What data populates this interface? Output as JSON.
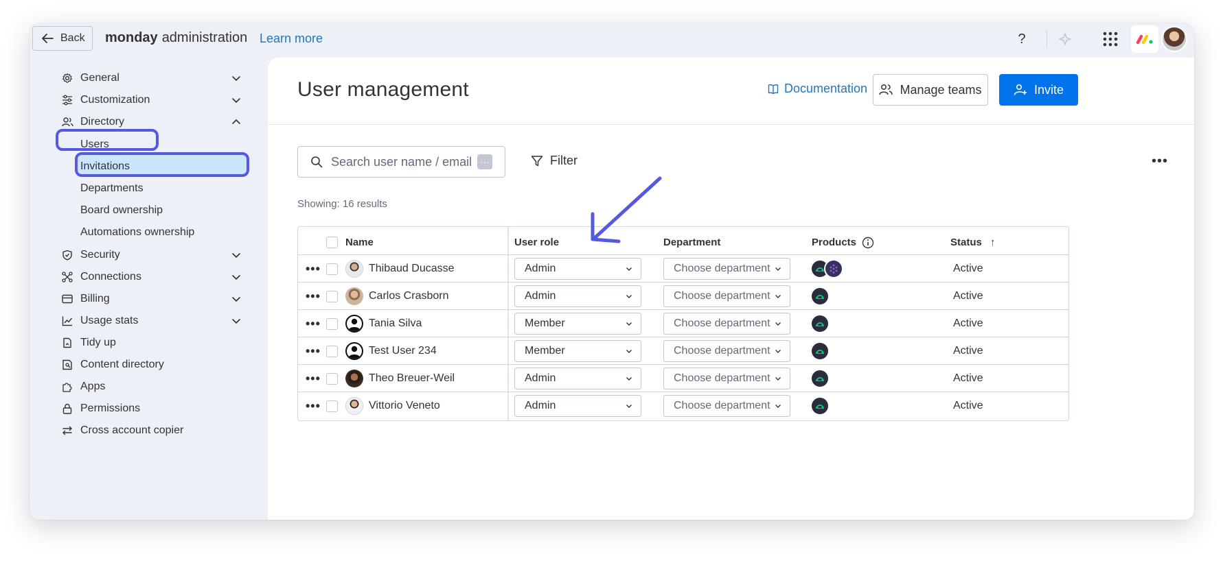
{
  "topbar": {
    "back_label": "Back",
    "brand_bold": "monday",
    "brand_rest": "administration",
    "learn_more": "Learn more",
    "help_label": "?"
  },
  "sidebar": {
    "items": [
      {
        "label": "General",
        "icon": "gear-icon",
        "expandable": true
      },
      {
        "label": "Customization",
        "icon": "sliders-icon",
        "expandable": true
      },
      {
        "label": "Directory",
        "icon": "users-icon",
        "expandable": true,
        "expanded": true
      },
      {
        "label": "Security",
        "icon": "shield-icon",
        "expandable": true
      },
      {
        "label": "Connections",
        "icon": "connections-icon",
        "expandable": true
      },
      {
        "label": "Billing",
        "icon": "card-icon",
        "expandable": true
      },
      {
        "label": "Usage stats",
        "icon": "chart-icon",
        "expandable": true
      },
      {
        "label": "Tidy up",
        "icon": "broom-icon",
        "expandable": false
      },
      {
        "label": "Content directory",
        "icon": "folder-icon",
        "expandable": false
      },
      {
        "label": "Apps",
        "icon": "puzzle-icon",
        "expandable": false
      },
      {
        "label": "Permissions",
        "icon": "lock-icon",
        "expandable": false
      },
      {
        "label": "Cross account copier",
        "icon": "arrows-icon",
        "expandable": false
      }
    ],
    "directory_sub": [
      "Users",
      "Invitations",
      "Departments",
      "Board ownership",
      "Automations ownership"
    ],
    "active_sub": "Users"
  },
  "main": {
    "title": "User management",
    "documentation": "Documentation",
    "manage_teams": "Manage teams",
    "invite": "Invite",
    "search_placeholder": "Search user name / email",
    "filter": "Filter",
    "showing": "Showing: 16 results",
    "more": "•••"
  },
  "table": {
    "columns": {
      "name": "Name",
      "role": "User role",
      "department": "Department",
      "products": "Products",
      "status": "Status",
      "status_sort": "↑"
    },
    "rows": [
      {
        "name": "Thibaud Ducasse",
        "role": "Admin",
        "department": "Choose department",
        "products": [
          "monday-work-management",
          "monday-dev"
        ],
        "status": "Active"
      },
      {
        "name": "Carlos Crasborn",
        "role": "Admin",
        "department": "Choose department",
        "products": [
          "monday-work-management"
        ],
        "status": "Active"
      },
      {
        "name": "Tania Silva",
        "role": "Member",
        "department": "Choose department",
        "products": [
          "monday-work-management"
        ],
        "status": "Active"
      },
      {
        "name": "Test User 234",
        "role": "Member",
        "department": "Choose department",
        "products": [
          "monday-work-management"
        ],
        "status": "Active"
      },
      {
        "name": "Theo Breuer-Weil",
        "role": "Admin",
        "department": "Choose department",
        "products": [
          "monday-work-management"
        ],
        "status": "Active"
      },
      {
        "name": "Vittorio Veneto",
        "role": "Admin",
        "department": "Choose department",
        "products": [
          "monday-work-management"
        ],
        "status": "Active"
      }
    ],
    "row_more": "•••"
  },
  "colors": {
    "accent": "#0073ea",
    "highlight": "#5559df",
    "selected_bg": "#cce5ff",
    "product_bg": "#2b2c3e",
    "product_green": "#00c875"
  }
}
